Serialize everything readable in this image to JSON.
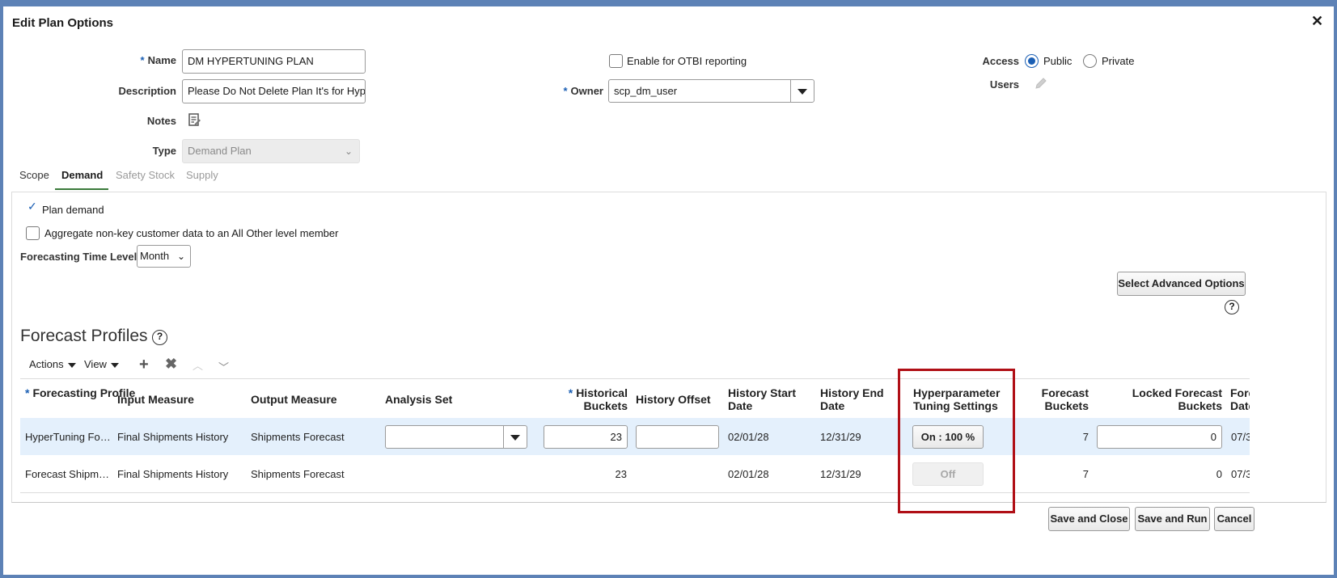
{
  "dialog": {
    "title": "Edit Plan Options"
  },
  "form": {
    "name_label": "Name",
    "name_value": "DM HYPERTUNING PLAN",
    "description_label": "Description",
    "description_value": "Please Do Not Delete Plan It's for Hype",
    "notes_label": "Notes",
    "type_label": "Type",
    "type_value": "Demand Plan",
    "otbi_label": "Enable for OTBI reporting",
    "owner_label": "Owner",
    "owner_value": "scp_dm_user",
    "access_label": "Access",
    "access_public": "Public",
    "access_private": "Private",
    "users_label": "Users",
    "required_marker": "*"
  },
  "tabs": [
    "Scope",
    "Demand",
    "Safety Stock",
    "Supply"
  ],
  "demand": {
    "plan_demand_label": "Plan demand",
    "aggregate_label": "Aggregate non-key customer data to an All Other level member",
    "time_level_label": "Forecasting Time Level",
    "time_level_value": "Month",
    "advanced_button": "Select Advanced Options"
  },
  "profiles": {
    "heading": "Forecast Profiles",
    "toolbar": {
      "actions": "Actions",
      "view": "View"
    },
    "columns": {
      "forecasting_profile": "Forecasting Profile",
      "input_measure": "Input Measure",
      "output_measure": "Output Measure",
      "analysis_set": "Analysis Set",
      "historical_buckets": "Historical Buckets",
      "history_offset": "History Offset",
      "history_start_date": "History Start Date",
      "history_end_date": "History End Date",
      "hyperparameter": "Hyperparameter Tuning Settings",
      "forecast_buckets": "Forecast Buckets",
      "locked_forecast_buckets": "Locked Forecast Buckets",
      "forecast_date_partial": "Fore Date"
    },
    "rows": [
      {
        "profile": "HyperTuning Fo…",
        "input": "Final Shipments History",
        "output": "Shipments Forecast",
        "historical_buckets": "23",
        "start": "02/01/28",
        "end": "12/31/29",
        "hyper": "On : 100 %",
        "forecast_buckets": "7",
        "locked": "0",
        "date_partial": "07/3"
      },
      {
        "profile": "Forecast Shipm…",
        "input": "Final Shipments History",
        "output": "Shipments Forecast",
        "historical_buckets": "23",
        "start": "02/01/28",
        "end": "12/31/29",
        "hyper": "Off",
        "forecast_buckets": "7",
        "locked": "0",
        "date_partial": "07/3"
      }
    ]
  },
  "footer": {
    "save_close": "Save and Close",
    "save_run": "Save and Run",
    "cancel": "Cancel"
  }
}
